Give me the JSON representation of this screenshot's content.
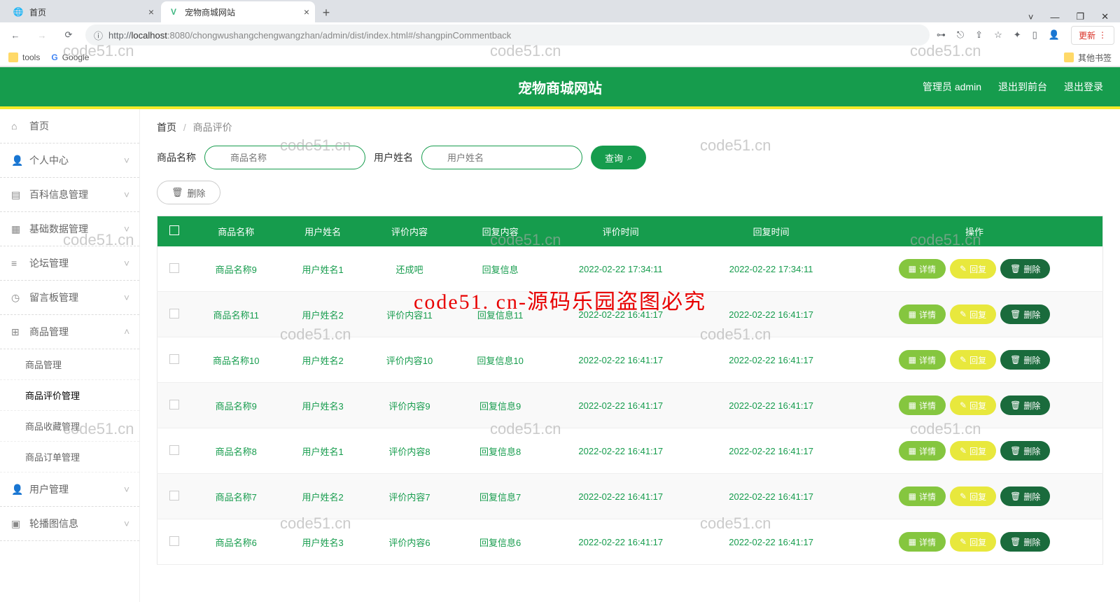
{
  "browser": {
    "tabs": [
      {
        "title": "首页",
        "active": false
      },
      {
        "title": "宠物商城网站",
        "active": true
      }
    ],
    "url_host": "localhost",
    "url_prefix": "http://",
    "url_port": ":8080",
    "url_path": "/chongwushangchengwangzhan/admin/dist/index.html#/shangpinCommentback",
    "update_label": "更新",
    "bookmarks": [
      "tools",
      "Google"
    ],
    "other_bookmarks": "其他书签"
  },
  "header": {
    "title": "宠物商城网站",
    "links": [
      "管理员 admin",
      "退出到前台",
      "退出登录"
    ]
  },
  "sidebar": {
    "items": [
      {
        "icon": "home",
        "label": "首页",
        "type": "item"
      },
      {
        "icon": "user",
        "label": "个人中心",
        "type": "group"
      },
      {
        "icon": "book",
        "label": "百科信息管理",
        "type": "group"
      },
      {
        "icon": "db",
        "label": "基础数据管理",
        "type": "group"
      },
      {
        "icon": "bars",
        "label": "论坛管理",
        "type": "group"
      },
      {
        "icon": "clock",
        "label": "留言板管理",
        "type": "group"
      },
      {
        "icon": "grid",
        "label": "商品管理",
        "type": "group",
        "expanded": true,
        "children": [
          "商品管理",
          "商品评价管理",
          "商品收藏管理",
          "商品订单管理"
        ],
        "current": "商品评价管理"
      },
      {
        "icon": "user",
        "label": "用户管理",
        "type": "group"
      },
      {
        "icon": "image",
        "label": "轮播图信息",
        "type": "group"
      }
    ]
  },
  "breadcrumb": {
    "root": "首页",
    "current": "商品评价"
  },
  "filters": {
    "f1_label": "商品名称",
    "f1_placeholder": "商品名称",
    "f2_label": "用户姓名",
    "f2_placeholder": "用户姓名",
    "query": "查询"
  },
  "batch_delete": "删除",
  "table": {
    "headers": [
      "",
      "商品名称",
      "用户姓名",
      "评价内容",
      "回复内容",
      "评价时间",
      "回复时间",
      "操作"
    ],
    "ops": {
      "detail": "详情",
      "reply": "回复",
      "delete": "删除"
    },
    "rows": [
      {
        "name": "商品名称9",
        "user": "用户姓名1",
        "comment": "还成吧",
        "reply": "回复信息",
        "ctime": "2022-02-22 17:34:11",
        "rtime": "2022-02-22 17:34:11"
      },
      {
        "name": "商品名称11",
        "user": "用户姓名2",
        "comment": "评价内容11",
        "reply": "回复信息11",
        "ctime": "2022-02-22 16:41:17",
        "rtime": "2022-02-22 16:41:17"
      },
      {
        "name": "商品名称10",
        "user": "用户姓名2",
        "comment": "评价内容10",
        "reply": "回复信息10",
        "ctime": "2022-02-22 16:41:17",
        "rtime": "2022-02-22 16:41:17"
      },
      {
        "name": "商品名称9",
        "user": "用户姓名3",
        "comment": "评价内容9",
        "reply": "回复信息9",
        "ctime": "2022-02-22 16:41:17",
        "rtime": "2022-02-22 16:41:17"
      },
      {
        "name": "商品名称8",
        "user": "用户姓名1",
        "comment": "评价内容8",
        "reply": "回复信息8",
        "ctime": "2022-02-22 16:41:17",
        "rtime": "2022-02-22 16:41:17"
      },
      {
        "name": "商品名称7",
        "user": "用户姓名2",
        "comment": "评价内容7",
        "reply": "回复信息7",
        "ctime": "2022-02-22 16:41:17",
        "rtime": "2022-02-22 16:41:17"
      },
      {
        "name": "商品名称6",
        "user": "用户姓名3",
        "comment": "评价内容6",
        "reply": "回复信息6",
        "ctime": "2022-02-22 16:41:17",
        "rtime": "2022-02-22 16:41:17"
      }
    ]
  },
  "watermarks": {
    "gray": "code51.cn",
    "red": "code51. cn-源码乐园盗图必究"
  }
}
